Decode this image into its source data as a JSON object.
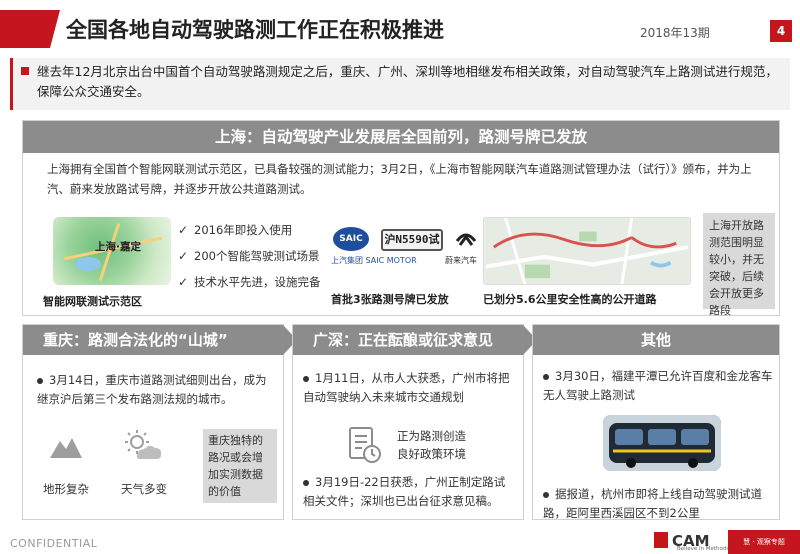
{
  "header": {
    "title": "全国各地自动驾驶路测工作正在积极推进",
    "date": "2018年13期",
    "page": "4"
  },
  "intro": "继去年12月北京出台中国首个自动驾驶路测规定之后，重庆、广州、深圳等地相继发布相关政策，对自动驾驶汽车上路测试进行规范，保障公众交通安全。",
  "shanghai": {
    "header": "上海：自动驾驶产业发展居全国前列，路测号牌已发放",
    "desc": "上海拥有全国首个智能网联测试示范区，已具备较强的测试能力；3月2日，《上海市智能网联汽车道路测试管理办法（试行）》颁布，并为上汽、蔚来发放路试号牌，并逐步开放公共道路测试。",
    "park_label": "上海·嘉定",
    "park_caption": "智能网联测试示范区",
    "checks": [
      "2016年即投入使用",
      "200个智能驾驶测试场景",
      "技术水平先进，设施完备"
    ],
    "saic_logo": "SAIC",
    "saic_text": "上汽集团 SAIC MOTOR",
    "plate": "沪N5590试",
    "nio_text": "蔚来汽车",
    "plates_caption": "首批3张路测号牌已发放",
    "route_caption": "已划分5.6公里安全性高的公开道路",
    "note": "上海开放路测范围明显较小，并无突破，后续会开放更多路段"
  },
  "chongqing": {
    "header": "重庆：路测合法化的“山城”",
    "bullet": "3月14日，重庆市道路测试细则出台，成为继京沪后第三个发布路测法规的城市。",
    "icon1_label": "地形复杂",
    "icon2_label": "天气多变",
    "note": "重庆独特的路况或会增加实测数据的价值"
  },
  "guangshen": {
    "header": "广深：正在酝酿或征求意见",
    "bullet1": "1月11日，从市人大获悉，广州市将把自动驾驶纳入未来城市交通规划",
    "policy_label": "正为路测创造良好政策环境",
    "bullet2": "3月19日-22日获悉，广州正制定路试相关文件；深圳也已出台征求意见稿。"
  },
  "others": {
    "header": "其他",
    "bullet1": "3月30日，福建平潭已允许百度和金龙客车无人驾驶上路测试",
    "bullet2": "据报道，杭州市即将上线自动驾驶测试道路，距阿里西溪园区不到2公里"
  },
  "footer": {
    "confidential": "CONFIDENTIAL",
    "logo": "CAM",
    "logo_sub": "Believe in Methods",
    "badge": "慧 · 观察专题"
  },
  "colors": {
    "accent": "#c4161c",
    "header_gray": "#8c8c8c",
    "note_gray": "#d9d9d9"
  }
}
